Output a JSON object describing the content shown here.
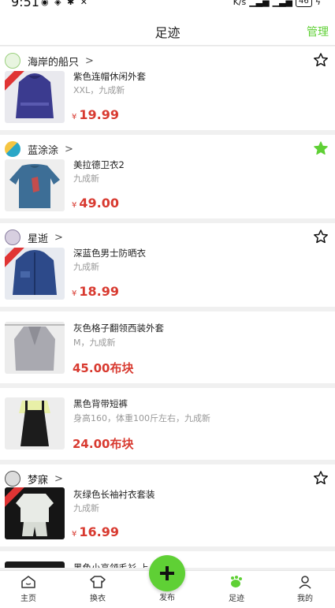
{
  "status_bar": {
    "time": "9:51",
    "net_speed": "K/s",
    "battery": "46"
  },
  "header": {
    "title": "足迹",
    "manage_label": "管理"
  },
  "accent_color": "#5fd035",
  "price_color": "#d83a30",
  "items": [
    {
      "seller": "海岸的船只",
      "title": "紫色连帽休闲外套",
      "sub": "XXL，九成新",
      "currency": "¥",
      "price": "19.99",
      "favorited": false
    },
    {
      "seller": "蓝涂涂",
      "title": "美拉德卫衣2",
      "sub": "九成新",
      "currency": "¥",
      "price": "49.00",
      "favorited": true
    },
    {
      "seller": "星逝",
      "title": "深蓝色男士防晒衣",
      "sub": "九成新",
      "currency": "¥",
      "price": "18.99",
      "favorited": false
    },
    {
      "title": "灰色格子翻领西装外套",
      "sub": "M，九成新",
      "price_text": "45.00布块"
    },
    {
      "title": "黑色背带短裤",
      "sub": "身高160，体重100斤左右，九成新",
      "price_text": "24.00布块"
    },
    {
      "seller": "梦寐",
      "title": "灰绿色长袖衬衣套装",
      "sub": "九成新",
      "currency": "¥",
      "price": "16.99",
      "favorited": false
    },
    {
      "title": "黑色小高领毛衫 上"
    }
  ],
  "tabbar": {
    "home": "主页",
    "swap": "换衣",
    "publish": "发布",
    "footprint": "足迹",
    "mine": "我的",
    "active": "footprint"
  }
}
